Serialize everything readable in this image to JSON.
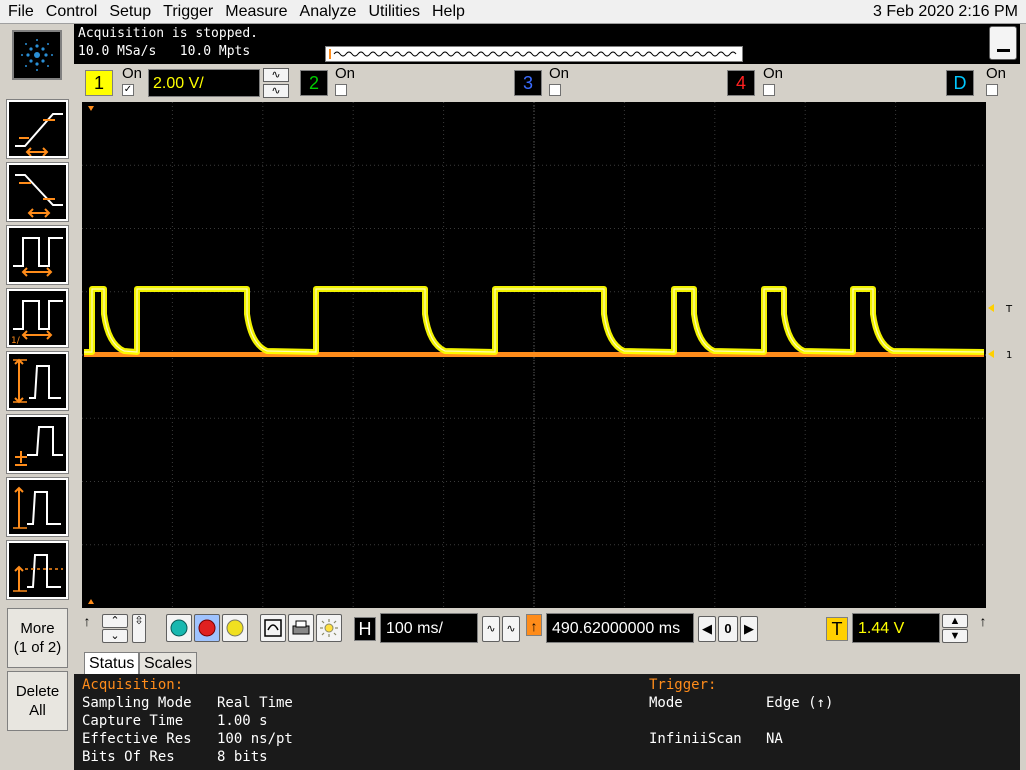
{
  "menu": {
    "items": [
      "File",
      "Control",
      "Setup",
      "Trigger",
      "Measure",
      "Analyze",
      "Utilities",
      "Help"
    ],
    "datetime": "3 Feb 2020  2:16 PM"
  },
  "acquisition_header": {
    "line1": "Acquisition is stopped.",
    "line2": "10.0 MSa/s   10.0 Mpts"
  },
  "channels": {
    "ch1": {
      "label": "1",
      "on_label": "On",
      "checked": "✓",
      "scale": "2.00 V/",
      "color": "#ffff00"
    },
    "ch2": {
      "label": "2",
      "on_label": "On",
      "color": "#00cc00"
    },
    "ch3": {
      "label": "3",
      "on_label": "On",
      "color": "#3b6cff"
    },
    "ch4": {
      "label": "4",
      "on_label": "On",
      "color": "#ff2020"
    },
    "digital": {
      "label": "D",
      "on_label": "On",
      "color": "#00c8ff"
    }
  },
  "left_buttons": {
    "more": "More\n(1 of 2)",
    "delete_all": "Delete\nAll"
  },
  "waveform": {
    "trigger_marker": "T",
    "channel_marker": "1",
    "trace_color": "#ffff00",
    "reference_color": "#ff8c1a"
  },
  "horizontal": {
    "tag": "H",
    "timebase": "100 ms/",
    "position_tag": "↑",
    "delay": "490.62000000 ms",
    "zero_label": "0"
  },
  "trigger_control": {
    "tag": "T",
    "level": "1.44 V",
    "slope_icon": "↑"
  },
  "tabs": [
    "Status",
    "Scales"
  ],
  "status": {
    "acquisition_title": "Acquisition:",
    "rows": [
      {
        "label": "Sampling Mode",
        "value": "Real Time"
      },
      {
        "label": "Capture Time",
        "value": "1.00 s"
      },
      {
        "label": "Effective Res",
        "value": "100 ns/pt"
      },
      {
        "label": "Bits Of Res",
        "value": "8 bits"
      }
    ],
    "trigger_title": "Trigger:",
    "trigger_rows": [
      {
        "label": "Mode",
        "value": "Edge (↑)"
      },
      {
        "label": "InfiniiScan",
        "value": "NA"
      }
    ]
  }
}
